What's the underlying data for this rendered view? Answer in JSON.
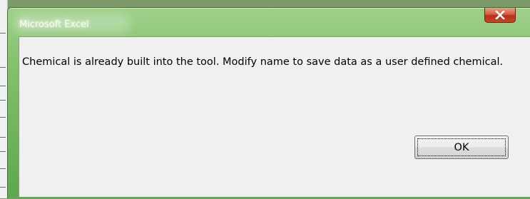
{
  "window": {
    "title": "Microsoft Excel"
  },
  "dialog": {
    "message": "Chemical is already built into the tool.  Modify name to save data as a user defined chemical.",
    "ok_label": "OK"
  },
  "icons": {
    "close": "close-icon"
  },
  "colors": {
    "titlebar": "#7fbf6a",
    "close_button": "#c8472c",
    "dialog_background": "#f0f0f0"
  }
}
